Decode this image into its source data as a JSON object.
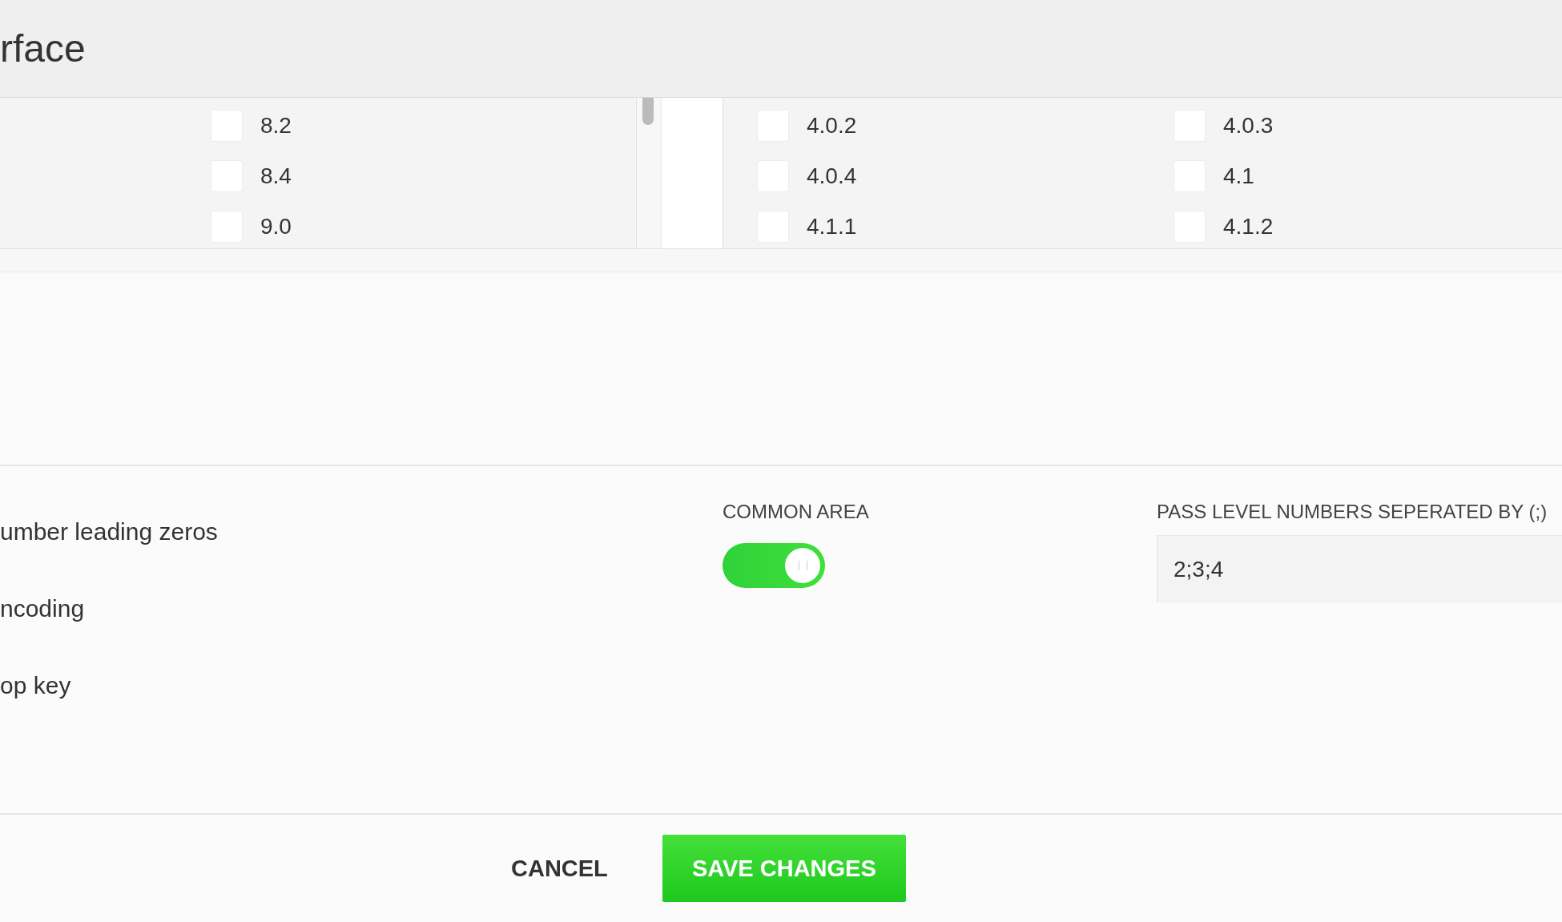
{
  "window": {
    "title": "rface"
  },
  "left_list": {
    "items": [
      {
        "label": "8.2",
        "checked": false
      },
      {
        "label": "8.4",
        "checked": false
      },
      {
        "label": "9.0",
        "checked": false
      }
    ]
  },
  "right_list": {
    "items": [
      {
        "label": "4.0.2",
        "checked": false
      },
      {
        "label": "4.0.3",
        "checked": false
      },
      {
        "label": "4.0.4",
        "checked": false
      },
      {
        "label": "4.1",
        "checked": false
      },
      {
        "label": "4.1.1",
        "checked": false
      },
      {
        "label": "4.1.2",
        "checked": false
      }
    ]
  },
  "settings": {
    "labels": [
      "umber leading zeros",
      "ncoding",
      "op key"
    ],
    "common_area": {
      "label": "COMMON AREA",
      "on": true
    },
    "pass_levels": {
      "label": "PASS LEVEL NUMBERS SEPERATED BY (;)",
      "value": "2;3;4"
    }
  },
  "buttons": [
    {
      "label": "CANCEL",
      "kind": "text"
    },
    {
      "label": "SAVE CHANGES",
      "kind": "primary"
    }
  ]
}
